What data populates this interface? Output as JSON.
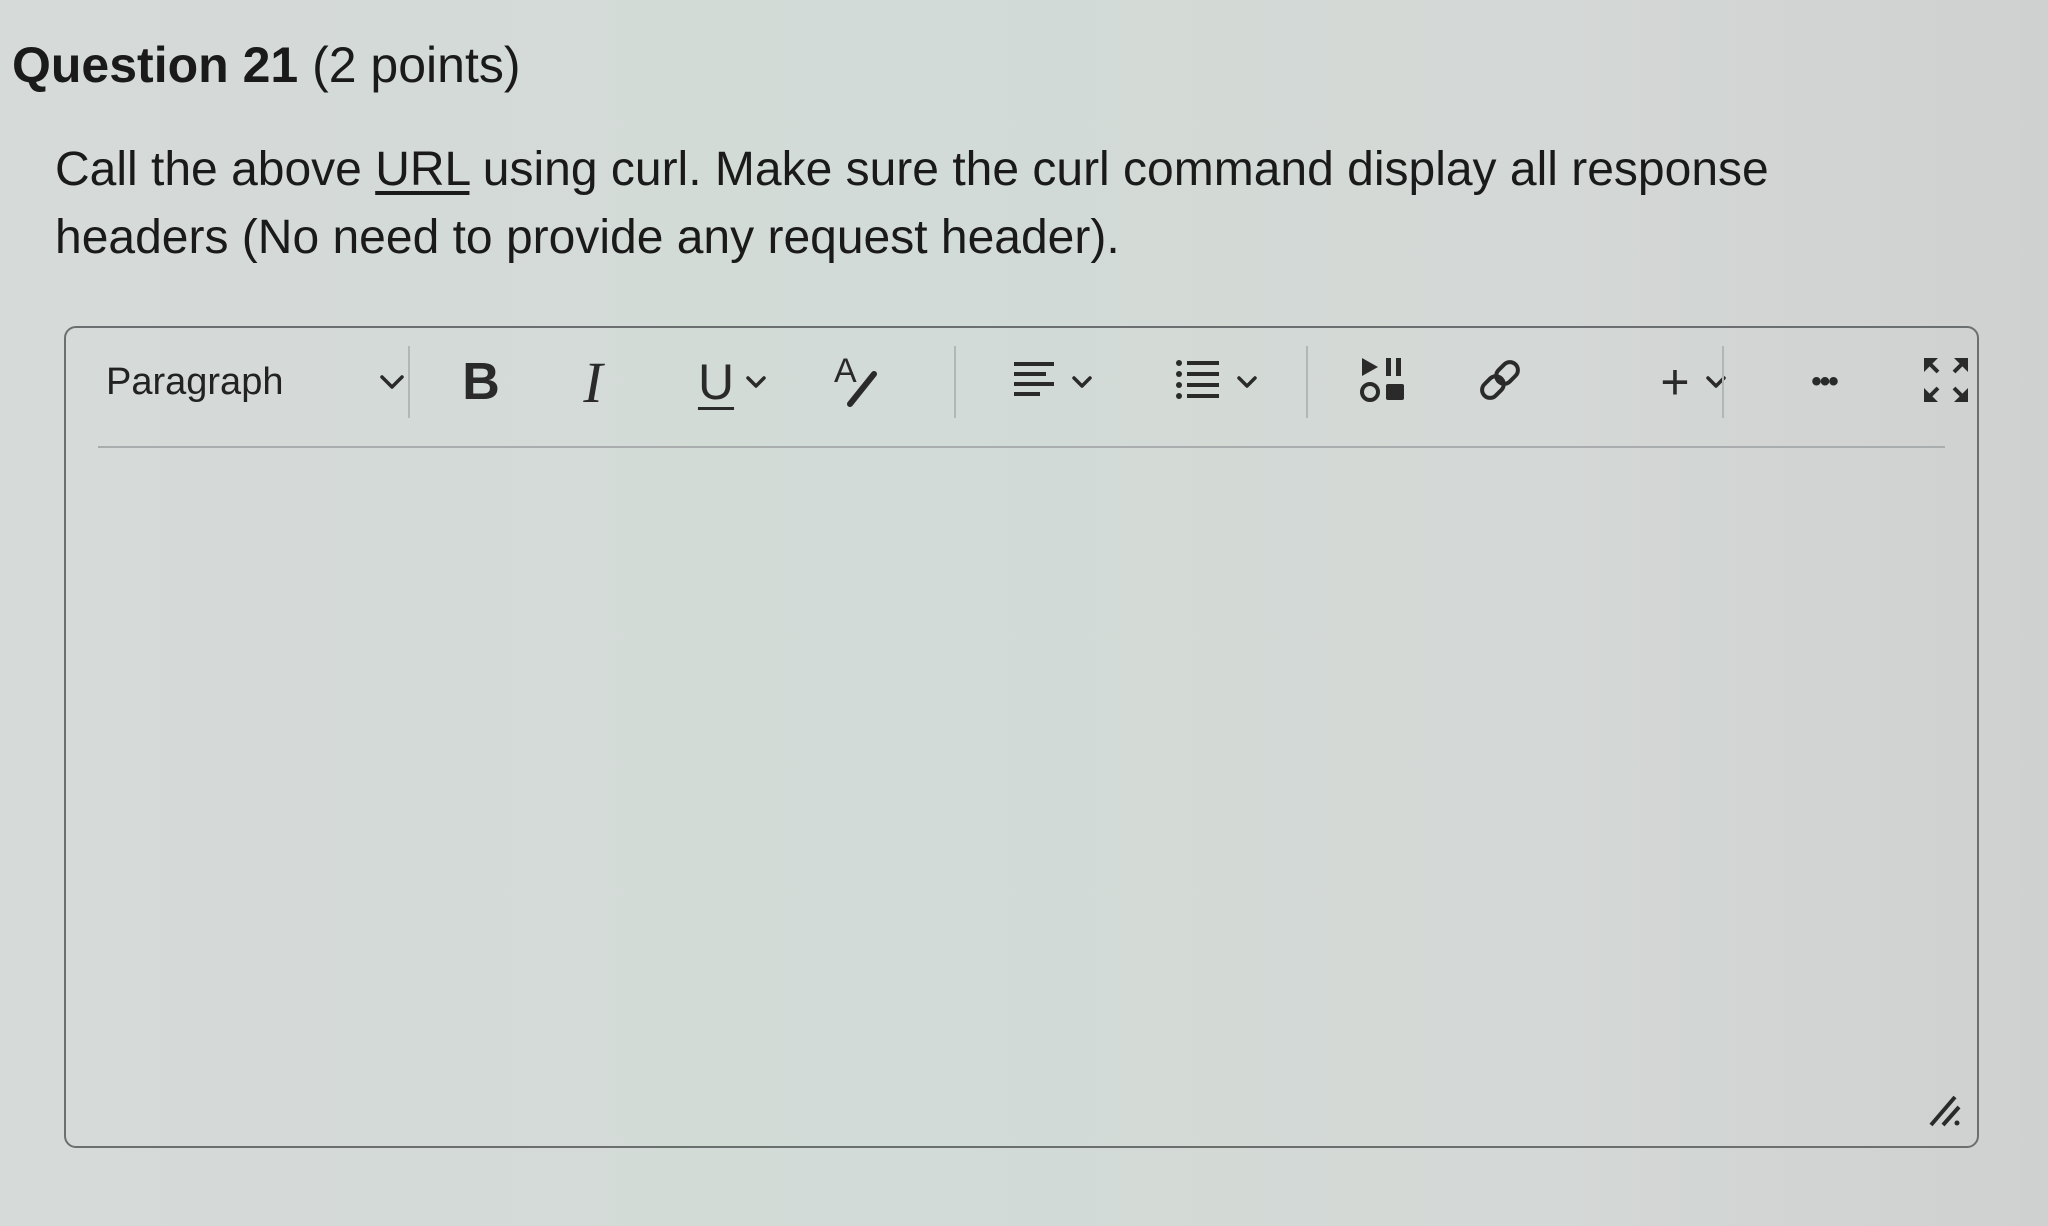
{
  "question": {
    "title_bold": "Question 21",
    "title_points": " (2 points)",
    "prompt_before": "Call the above ",
    "prompt_link": "URL",
    "prompt_after": " using curl. Make sure the curl command display all response headers (No need to provide any request header)."
  },
  "editor": {
    "block_format": "Paragraph",
    "toolbar_icons": [
      "bold-icon",
      "italic-icon",
      "underline-icon",
      "text-color-icon",
      "align-icon",
      "list-icon",
      "media-icon",
      "link-icon",
      "insert-icon",
      "more-icon",
      "fullscreen-icon"
    ],
    "bold_glyph": "B",
    "italic_glyph": "I",
    "underline_glyph": "U",
    "text_color_glyph": "A",
    "insert_glyph": "+",
    "more_glyph": "•••"
  }
}
